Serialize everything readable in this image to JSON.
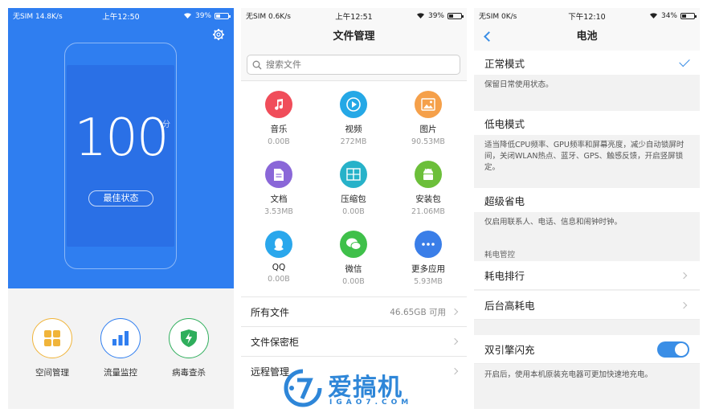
{
  "phone1": {
    "status": {
      "carrier": "无SIM 14.8K/s",
      "time": "上午12:50",
      "battery": "39%"
    },
    "score": "100",
    "score_unit": "分",
    "state_button": "最佳状态",
    "tools": [
      {
        "label": "空间管理",
        "icon": "storage-grid-icon",
        "color": "#f0b43a"
      },
      {
        "label": "流量监控",
        "icon": "bar-chart-icon",
        "color": "#2f7ef0"
      },
      {
        "label": "病毒查杀",
        "icon": "shield-bolt-icon",
        "color": "#2fae5c"
      }
    ]
  },
  "phone2": {
    "status": {
      "carrier": "无SIM 0.6K/s",
      "time": "上午12:51",
      "battery": "39%"
    },
    "title": "文件管理",
    "search_placeholder": "搜索文件",
    "categories": [
      {
        "name": "音乐",
        "size": "0.00B",
        "icon": "music-icon",
        "color": "#f04d5a"
      },
      {
        "name": "视频",
        "size": "272MB",
        "icon": "play-icon",
        "color": "#25a8e6"
      },
      {
        "name": "图片",
        "size": "90.53MB",
        "icon": "image-icon",
        "color": "#f5a04a"
      },
      {
        "name": "文档",
        "size": "3.53MB",
        "icon": "document-icon",
        "color": "#8a67d8"
      },
      {
        "name": "压缩包",
        "size": "0.00B",
        "icon": "archive-icon",
        "color": "#27b2c9"
      },
      {
        "name": "安装包",
        "size": "21.06MB",
        "icon": "android-icon",
        "color": "#6cbf3a"
      },
      {
        "name": "QQ",
        "size": "0.00B",
        "icon": "qq-icon",
        "color": "#2aa7ec"
      },
      {
        "name": "微信",
        "size": "0.00B",
        "icon": "wechat-icon",
        "color": "#3fc04a"
      },
      {
        "name": "更多应用",
        "size": "5.93MB",
        "icon": "more-icon",
        "color": "#3a7ee8"
      }
    ],
    "list": [
      {
        "label": "所有文件",
        "value": "46.65GB 可用"
      },
      {
        "label": "文件保密柜",
        "value": ""
      },
      {
        "label": "远程管理",
        "value": ""
      }
    ]
  },
  "phone3": {
    "status": {
      "carrier": "无SIM 0K/s",
      "time": "下午12:10",
      "battery": "34%"
    },
    "title": "电池",
    "modes": [
      {
        "title": "正常模式",
        "desc": "保留日常使用状态。",
        "selected": true
      },
      {
        "title": "低电模式",
        "desc": "适当降低CPU频率、GPU频率和屏幕亮度，减少自动锁屏时间，关闭WLAN热点、蓝牙、GPS、触感反馈，开启竖屏锁定。",
        "selected": false
      },
      {
        "title": "超级省电",
        "desc": "仅启用联系人、电话、信息和闹钟时钟。",
        "selected": false
      }
    ],
    "section_label": "耗电管控",
    "rows": [
      {
        "label": "耗电排行"
      },
      {
        "label": "后台高耗电"
      }
    ],
    "dual_engine": {
      "label": "双引擎闪充",
      "enabled": true,
      "note": "开启后，使用本机原装充电器可更加快速地充电。"
    }
  },
  "watermark": {
    "name": "爱搞机",
    "url": "IGAO7.COM"
  }
}
